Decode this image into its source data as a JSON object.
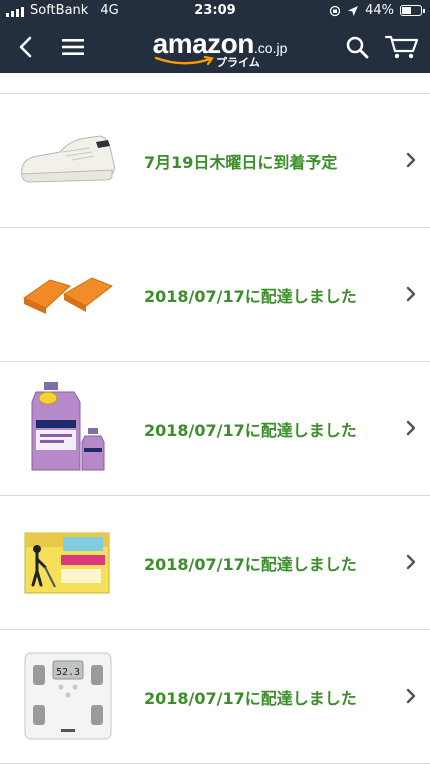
{
  "status_bar": {
    "carrier": "SoftBank",
    "network": "4G",
    "time": "23:09",
    "battery": "44%"
  },
  "header": {
    "logo_text": "amazon",
    "logo_tld": ".co.jp",
    "logo_sub": "プライム"
  },
  "orders": [
    {
      "status": "7月19日木曜日に到着予定",
      "image": "sneaker-image"
    },
    {
      "status": "2018/07/17に配達しました",
      "image": "sponge-image"
    },
    {
      "status": "2018/07/17に配達しました",
      "image": "mouthwash-image"
    },
    {
      "status": "2018/07/17に配達しました",
      "image": "wiper-sheets-image"
    },
    {
      "status": "2018/07/17に配達しました",
      "image": "scale-image"
    }
  ],
  "scale_display": "52.3",
  "colors": {
    "header_bg": "#232f3e",
    "status_green": "#3c8e2a",
    "logo_orange": "#ff9900"
  }
}
